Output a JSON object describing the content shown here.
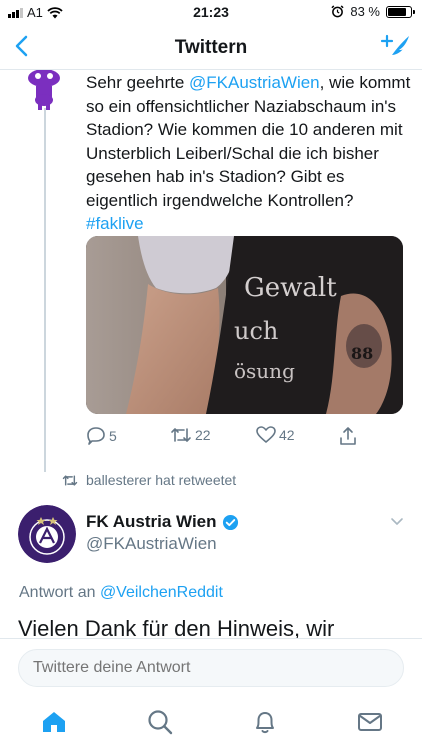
{
  "status_bar": {
    "carrier": "A1",
    "time": "21:23",
    "battery_percent": "83 %",
    "battery_level": 0.83
  },
  "nav": {
    "title": "Twittern"
  },
  "parent_tweet": {
    "text_before": "Sehr geehrte ",
    "mention": "@FKAustriaWien",
    "text_middle": ", wie kommt so ein offensichtlicher Naziabschaum in's Stadion? Wie kommen die 10 anderen mit Unsterblich Leiberl/Schal die ich bisher gesehen hab in's Stadion? Gibt es eigentlich irgendwelche Kontrollen? ",
    "hashtag": "#faklive",
    "replies": "5",
    "retweets": "22",
    "likes": "42"
  },
  "retweet_label": "ballesterer hat retweetet",
  "reply_tweet": {
    "author_name": "FK Austria Wien",
    "author_handle": "@FKAustriaWien",
    "reply_prefix": "Antwort an ",
    "reply_to": "@VeilchenReddit",
    "body_preview": "Vielen Dank für den Hinweis, wir"
  },
  "composer": {
    "placeholder": "Twittere deine Antwort"
  },
  "colors": {
    "accent": "#1da1f2",
    "secondary_text": "#657786",
    "fk_purple": "#3b1f6e",
    "reddit_purple": "#7b2fbf"
  },
  "icons": {
    "back": "chevron-left-icon",
    "compose": "compose-tweet-icon",
    "reply": "reply-icon",
    "retweet": "retweet-icon",
    "like": "heart-icon",
    "share": "share-icon",
    "verified": "verified-badge-icon",
    "home": "home-icon",
    "search": "search-icon",
    "notifications": "bell-icon",
    "messages": "mail-icon"
  }
}
